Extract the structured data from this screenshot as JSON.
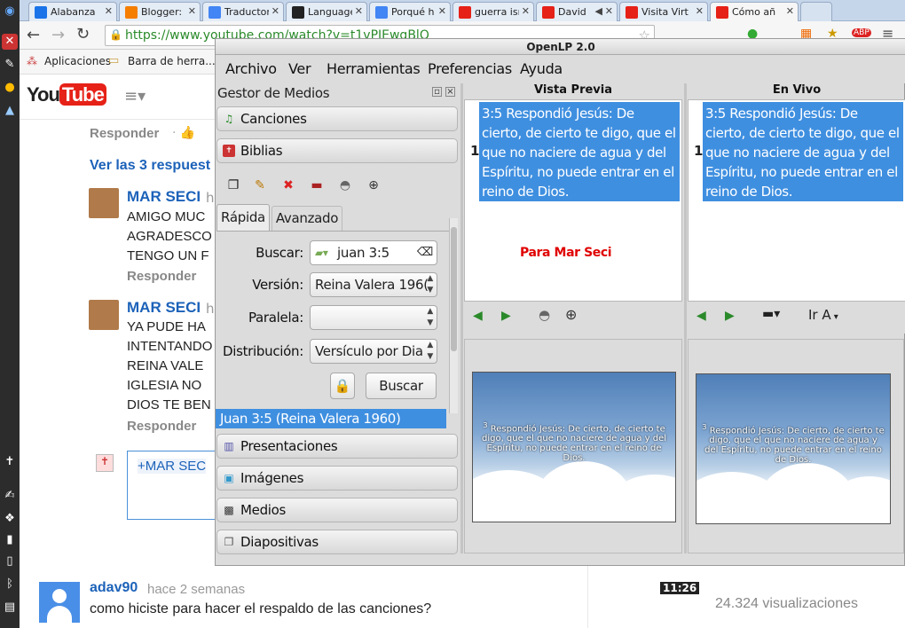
{
  "tabs": [
    {
      "label": "Alabanza",
      "color": "#1a73e8"
    },
    {
      "label": "Blogger:",
      "color": "#f57d00"
    },
    {
      "label": "Traductor",
      "color": "#4285f4"
    },
    {
      "label": "Language",
      "color": "#222222"
    },
    {
      "label": "Porqué h",
      "color": "#4285f4"
    },
    {
      "label": "guerra isr",
      "color": "#e62117"
    },
    {
      "label": "David",
      "color": "#e62117"
    },
    {
      "label": "Visita Virt",
      "color": "#e62117"
    },
    {
      "label": "Cómo añ",
      "color": "#e62117"
    }
  ],
  "browser": {
    "url": "https://www.youtube.com/watch?v=t1vPIEwqBlQ",
    "bookmarks": {
      "apps": "Aplicaciones",
      "bar": "Barra de herra..."
    }
  },
  "youtube": {
    "logo_you": "You",
    "logo_tube": "Tube",
    "reply1": "Responder",
    "see_replies": "Ver las 3 respuest",
    "comments": [
      {
        "name": "MAR SECI",
        "time": "h",
        "lines": [
          "AMIGO MUC",
          "AGRADESCO",
          "TENGO UN F"
        ],
        "reply": "Responder"
      },
      {
        "name": "MAR SECI",
        "time": "h",
        "lines": [
          "YA PUDE HA",
          "INTENTANDO",
          "REINA VALE",
          "IGLESIA NO",
          "DIOS TE BEN"
        ],
        "reply": "Responder"
      }
    ],
    "reply_input": "+MAR SEC",
    "adav": {
      "name": "adav90",
      "time": "hace 2 semanas",
      "text": "como hiciste para hacer el respaldo de las canciones?"
    },
    "duration": "11:26",
    "views": "24.324 visualizaciones"
  },
  "openlp": {
    "title": "OpenLP 2.0",
    "menu": [
      "Archivo",
      "Ver",
      "Herramientas",
      "Preferencias",
      "Ayuda"
    ],
    "media_manager": "Gestor de Medios",
    "sections": {
      "songs": "Canciones",
      "bibles": "Biblias",
      "presentations": "Presentaciones",
      "images": "Imágenes",
      "media": "Medios",
      "slides": "Diapositivas"
    },
    "tabs": {
      "quick": "Rápida",
      "advanced": "Avanzado"
    },
    "form": {
      "search_label": "Buscar:",
      "search_value": "juan 3:5",
      "version_label": "Versión:",
      "version_value": "Reina Valera 196(",
      "parallel_label": "Paralela:",
      "parallel_value": "",
      "layout_label": "Distribución:",
      "layout_value": "Versículo por Dia",
      "search_button": "Buscar"
    },
    "result": "Juan 3:5 (Reina Valera 1960)",
    "preview": {
      "header": "Vista Previa",
      "row": "1",
      "verse": "3:5 Respondió Jesús: De cierto, de cierto te digo, que el que no naciere de agua y del Espíritu, no puede entrar en el reino de Dios.",
      "caption": "Para Mar Seci",
      "caption_color": "#e00000",
      "thumb_num": "3",
      "thumb_text": "Respondió Jesús: De cierto, de cierto te digo, que el que no naciere de agua y del Espíritu, no puede entrar en el reino de Dios."
    },
    "live": {
      "header": "En Vivo",
      "row": "1",
      "verse": "3:5 Respondió Jesús: De cierto, de cierto te digo, que el que no naciere de agua y del Espíritu, no puede entrar en el reino de Dios.",
      "goto": "Ir A",
      "thumb_num": "3",
      "thumb_text": "Respondió Jesús: De cierto, de cierto te digo, que el que no naciere de agua y del Espíritu, no puede entrar en el reino de Dios."
    },
    "accent": "#3f8fe0"
  }
}
